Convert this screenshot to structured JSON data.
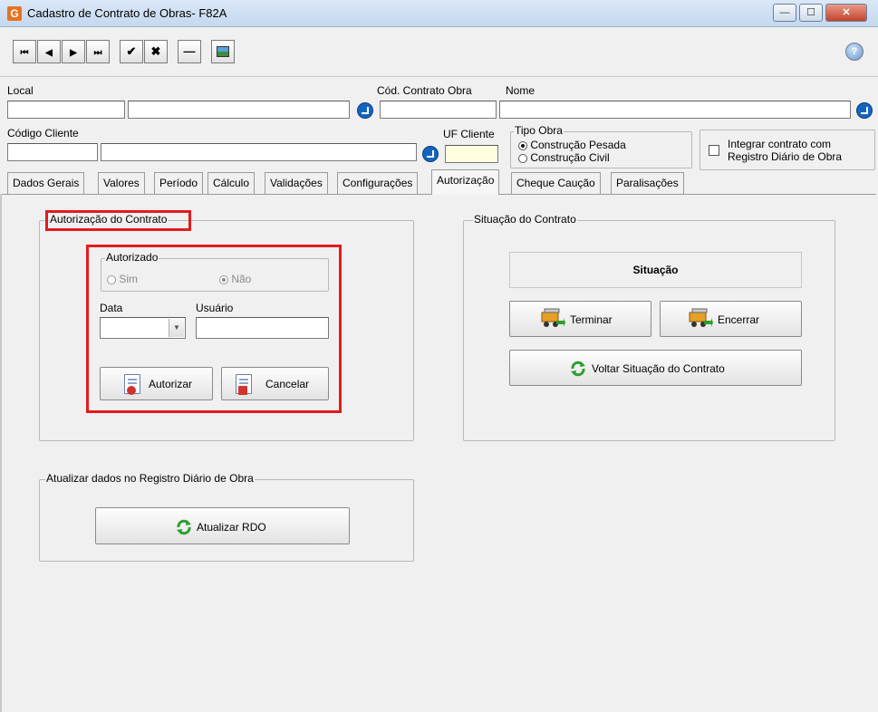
{
  "window": {
    "app_icon": "G",
    "title": "Cadastro de Contrato de Obras- F82A",
    "minimize_glyph": "—",
    "maximize_glyph": "☐",
    "close_glyph": "✕"
  },
  "toolbar": {
    "first_glyph": "⏮",
    "prev_glyph": "◀",
    "next_glyph": "▶",
    "last_glyph": "⏭",
    "confirm_glyph": "✔",
    "cancel_glyph": "✖",
    "remove_glyph": "—",
    "help_glyph": "?"
  },
  "header_form": {
    "local_label": "Local",
    "local_code_value": "",
    "local_name_value": "",
    "cod_contrato_label": "Cód. Contrato Obra",
    "cod_contrato_value": "",
    "nome_label": "Nome",
    "nome_value": "",
    "codigo_cliente_label": "Código Cliente",
    "codigo_cliente_value": "",
    "cliente_nome_value": "",
    "uf_cliente_label": "UF Cliente",
    "uf_cliente_value": "",
    "tipo_obra": {
      "legend": "Tipo Obra",
      "options": [
        "Construção Pesada",
        "Construção Civil"
      ],
      "selected": "Construção Pesada"
    },
    "integrar_label_line1": "Integrar contrato com",
    "integrar_label_line2": "Registro Diário de Obra",
    "integrar_checked": false
  },
  "tabs": [
    {
      "label": "Dados Gerais"
    },
    {
      "label": "Valores"
    },
    {
      "label": "Período"
    },
    {
      "label": "Cálculo"
    },
    {
      "label": "Validações"
    },
    {
      "label": "Configurações"
    },
    {
      "label": "Autorização",
      "active": true
    },
    {
      "label": "Cheque Caução"
    },
    {
      "label": "Paralisações"
    }
  ],
  "autorizacao": {
    "group_title": "Autorização do Contrato",
    "autorizado": {
      "legend": "Autorizado",
      "sim_label": "Sim",
      "nao_label": "Não",
      "selected": "Não"
    },
    "data_label": "Data",
    "data_value": "",
    "usuario_label": "Usuário",
    "usuario_value": "",
    "autorizar_button": "Autorizar",
    "cancelar_button": "Cancelar"
  },
  "situacao": {
    "group_title": "Situação do Contrato",
    "status_text": "Situação",
    "terminar_button": "Terminar",
    "encerrar_button": "Encerrar",
    "voltar_button": "Voltar Situação do Contrato"
  },
  "rdo": {
    "group_title": "Atualizar dados no Registro Diário de Obra",
    "atualizar_button": "Atualizar RDO"
  },
  "colors": {
    "highlight_red": "#e31b1b",
    "lookup_blue": "#1565c0",
    "uf_field_yellow": "#ffffe0",
    "refresh_green": "#2e9e2e"
  }
}
